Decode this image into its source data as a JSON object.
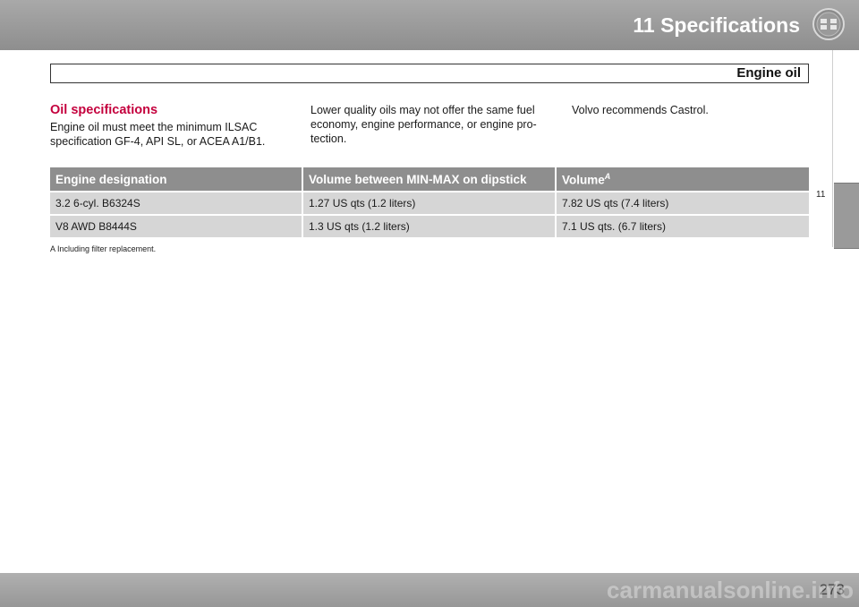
{
  "header": {
    "chapter_title": "11 Specifications",
    "section_title": "Engine oil",
    "chapter_icon": "gauge-cluster-icon"
  },
  "side_tab": {
    "label": "11"
  },
  "columns": {
    "col1": {
      "heading": "Oil specifications",
      "text": "Engine oil must meet the minimum ILSAC specification GF-4, API SL, or ACEA A1/B1."
    },
    "col2": {
      "text": "Lower quality oils may not offer the same fuel economy, engine performance, or engine pro-tection."
    },
    "col3": {
      "text": "Volvo recommends Castrol."
    }
  },
  "table": {
    "headers": [
      "Engine designation",
      "Volume between MIN-MAX on dipstick",
      "Volume"
    ],
    "header_sup": "A",
    "rows": [
      [
        "3.2 6-cyl. B6324S",
        "1.27 US qts (1.2 liters)",
        "7.82 US qts (7.4 liters)"
      ],
      [
        "V8 AWD B8444S",
        "1.3 US qts (1.2 liters)",
        "7.1 US qts. (6.7 liters)"
      ]
    ],
    "footnote_marker": "A",
    "footnote_text": "Including filter replacement."
  },
  "footer": {
    "page_number": "273",
    "watermark": "carmanualsonline.info"
  }
}
